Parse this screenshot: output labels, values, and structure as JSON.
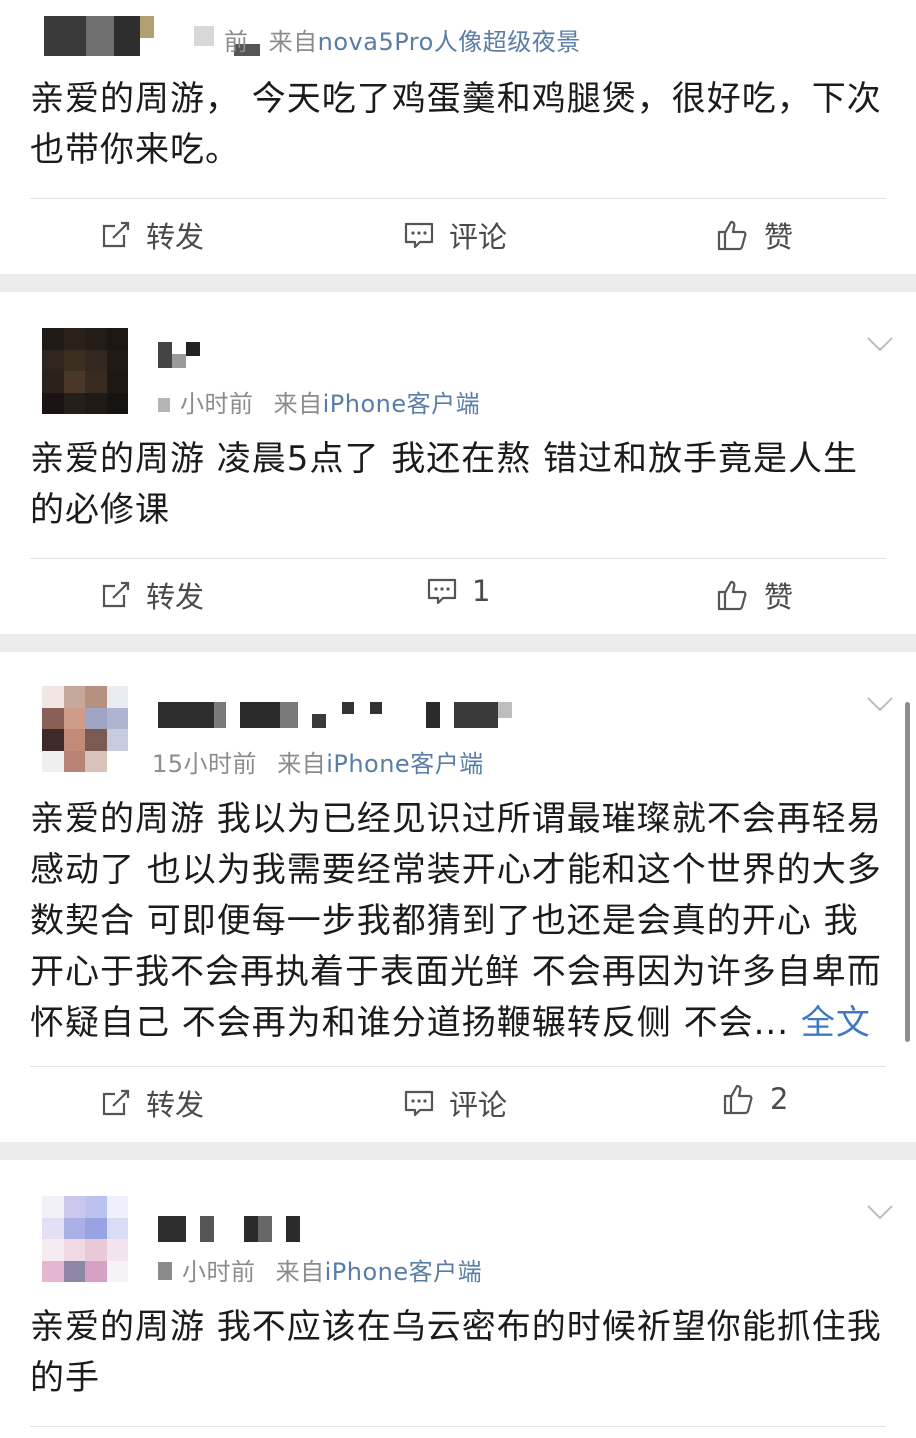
{
  "posts": [
    {
      "meta_time": "前",
      "meta_from": "来自",
      "meta_source": "nova5Pro人像超级夜景",
      "text": "亲爱的周游， 今天吃了鸡蛋羹和鸡腿煲，很好吃，下次也带你来吃。",
      "actions": {
        "repost": "转发",
        "comment": "评论",
        "like": "赞"
      }
    },
    {
      "meta_time": "小时前",
      "meta_from": "来自",
      "meta_source": "iPhone客户端",
      "text": "亲爱的周游 凌晨5点了 我还在熬 错过和放手竟是人生的必修课",
      "actions": {
        "repost": "转发",
        "comment": "1",
        "like": "赞"
      }
    },
    {
      "meta_time": "15小时前",
      "meta_from": "来自",
      "meta_source": "iPhone客户端",
      "text": "亲爱的周游 我以为已经见识过所谓最璀璨就不会再轻易感动了 也以为我需要经常装开心才能和这个世界的大多数契合 可即便每一步我都猜到了也还是会真的开心 我开心于我不会再执着于表面光鲜 不会再因为许多自卑而怀疑自己 不会再为和谁分道扬鞭辗转反侧 不会...",
      "more": "全文",
      "actions": {
        "repost": "转发",
        "comment": "评论",
        "like": "2"
      }
    },
    {
      "meta_time": "小时前",
      "meta_from": "来自",
      "meta_source": "iPhone客户端",
      "text": "亲爱的周游 我不应该在乌云密布的时候祈望你能抓住我的手"
    }
  ],
  "colors": {
    "link": "#3f79c4",
    "source": "#5a7da8",
    "meta": "#8c8c8c",
    "background": "#ececec"
  },
  "icons": [
    "repost-icon",
    "comment-icon",
    "like-icon",
    "chevron-down-icon"
  ]
}
